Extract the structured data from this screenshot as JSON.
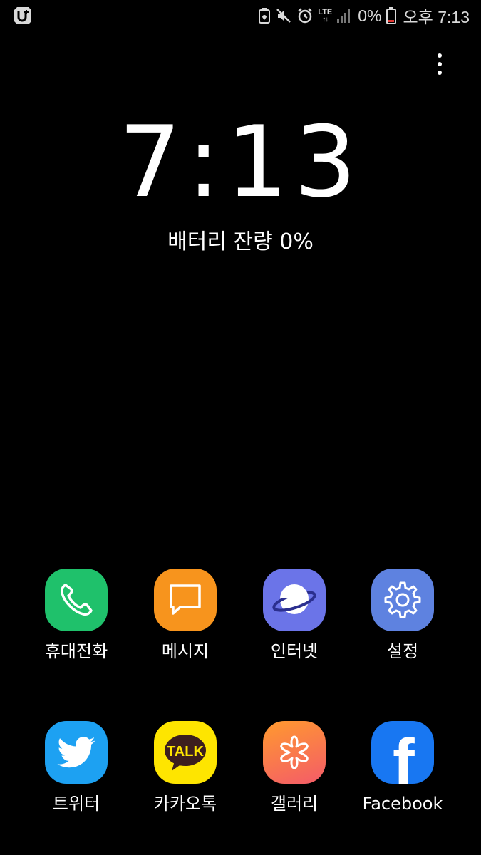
{
  "status_bar": {
    "carrier_icon": "uplus-carrier-icon",
    "icons": [
      "battery-saver-icon",
      "mute-icon",
      "alarm-icon",
      "lte-icon",
      "signal-icon"
    ],
    "lte_label": "LTE",
    "battery_percent": "0%",
    "time": "오후 7:13"
  },
  "clock": {
    "time": "7:13",
    "battery_remaining": "배터리 잔량 0%"
  },
  "apps": [
    {
      "label": "휴대전화",
      "icon": "phone-icon",
      "color": "#1fc16b"
    },
    {
      "label": "메시지",
      "icon": "message-icon",
      "color": "#f7941d"
    },
    {
      "label": "인터넷",
      "icon": "internet-icon",
      "color": "#6b74e8"
    },
    {
      "label": "설정",
      "icon": "settings-icon",
      "color": "#5e82e0"
    },
    {
      "label": "트위터",
      "icon": "twitter-icon",
      "color": "#1da1f2"
    },
    {
      "label": "카카오톡",
      "icon": "kakaotalk-icon",
      "color": "#fee500",
      "badge_text": "TALK"
    },
    {
      "label": "갤러리",
      "icon": "gallery-icon",
      "color": "#ff9a2e"
    },
    {
      "label": "Facebook",
      "icon": "facebook-icon",
      "color": "#1877f2",
      "glyph": "f"
    }
  ]
}
